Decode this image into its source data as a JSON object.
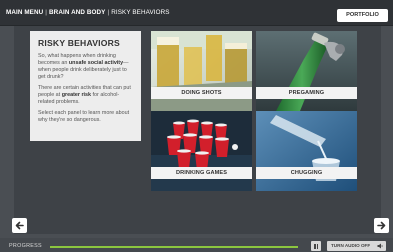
{
  "header": {
    "crumbs": [
      "MAIN MENU",
      "BRAIN AND BODY",
      "RISKY BEHAVIORS"
    ],
    "separator": "|",
    "portfolio_label": "PORTFOLIO"
  },
  "info": {
    "title": "RISKY BEHAVIORS",
    "p1_before": "So, what happens when drinking becomes an ",
    "p1_bold": "unsafe social activity",
    "p1_after": "—when people drink deliberately just to get drunk?",
    "p2_before": "There are certain activities that can put people at ",
    "p2_bold": "greater risk",
    "p2_after": " for alcohol-related problems.",
    "p3": "Select each panel to learn more about why they're so dangerous."
  },
  "panels": [
    {
      "label": "DOING SHOTS",
      "icon": "shot-glasses-photo"
    },
    {
      "label": "PREGAMING",
      "icon": "beer-bottle-photo"
    },
    {
      "label": "DRINKING GAMES",
      "icon": "red-cups-photo"
    },
    {
      "label": "CHUGGING",
      "icon": "pouring-glass-photo"
    }
  ],
  "footer": {
    "progress_label": "PROGRESS",
    "progress_fraction": 1.0,
    "audio_label": "TURN AUDIO OFF"
  },
  "colors": {
    "progress": "#8cc63f",
    "page_bg": "#4a4e53",
    "content_bg": "#3e4247"
  }
}
